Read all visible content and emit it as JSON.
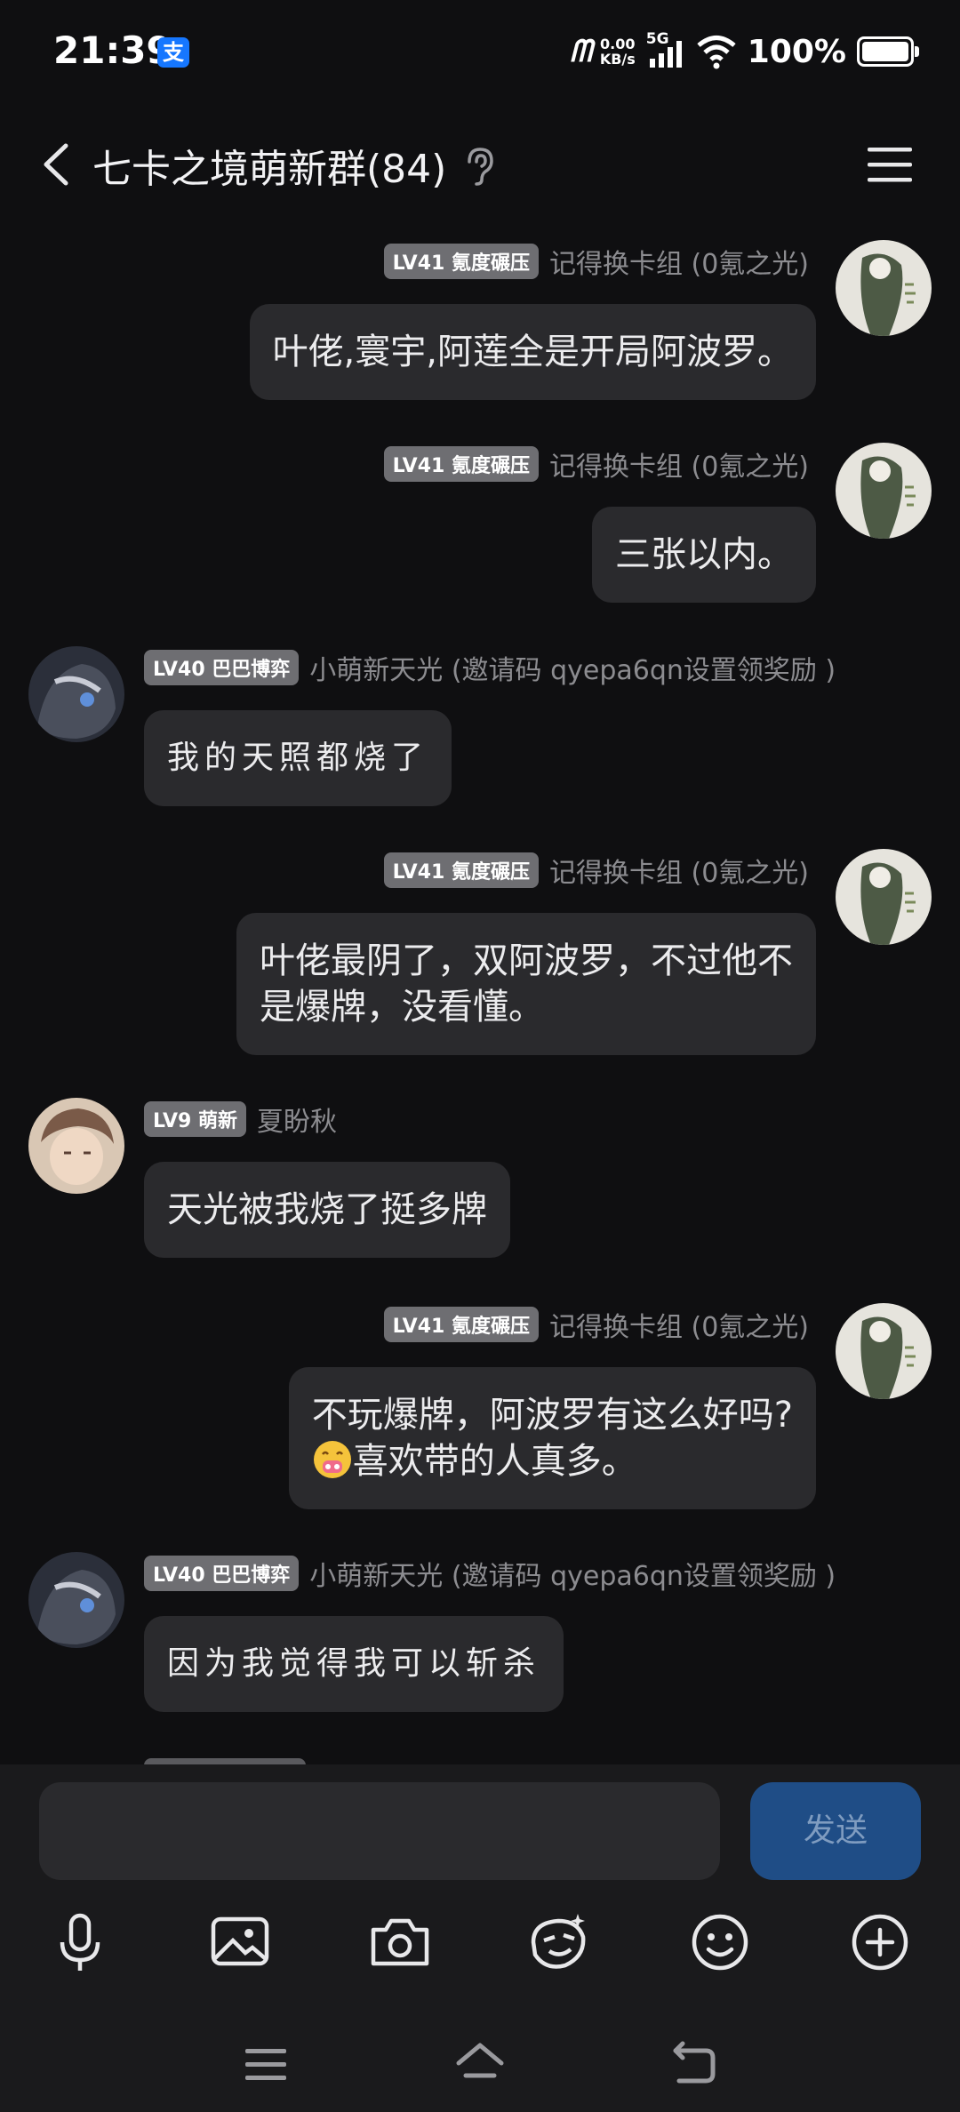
{
  "status_bar": {
    "time": "21:39",
    "alipay_badge": "支",
    "carrier": "ᗰ",
    "net_speed_value": "0.00",
    "net_speed_unit": "KB/s",
    "network": "5G",
    "battery_pct": "100%"
  },
  "header": {
    "title": "七卡之境萌新群(84)"
  },
  "messages": [
    {
      "side": "right",
      "level": "LV41 氪度碾压",
      "nick": "记得换卡组 (0氪之光)",
      "text": "叶佬,寰宇,阿莲全是开局阿波罗。"
    },
    {
      "side": "right",
      "level": "LV41 氪度碾压",
      "nick": "记得换卡组 (0氪之光)",
      "text": "三张以内。"
    },
    {
      "side": "left",
      "level": "LV40 巴巴博弈",
      "nick": "小萌新天光 (邀请码 qyepa6qn设置领奖励 )",
      "text": "我的天照都烧了"
    },
    {
      "side": "right",
      "level": "LV41 氪度碾压",
      "nick": "记得换卡组 (0氪之光)",
      "text_line1": "叶佬最阴了，双阿波罗，不过他不",
      "text_line2": "是爆牌，没看懂。"
    },
    {
      "side": "left",
      "level": "LV9 萌新",
      "nick": "夏盼秋",
      "text": "天光被我烧了挺多牌"
    },
    {
      "side": "right",
      "level": "LV41 氪度碾压",
      "nick": "记得换卡组 (0氪之光)",
      "text_line1": "不玩爆牌，阿波罗有这么好吗?",
      "text_line2": "喜欢带的人真多。",
      "emoji": "money-mouth-face-emoji"
    },
    {
      "side": "left",
      "level": "LV40 巴巴博弈",
      "nick": "小萌新天光 (邀请码 qyepa6qn设置领奖励 )",
      "text": "因为我觉得我可以斩杀"
    }
  ],
  "composer": {
    "input_value": "",
    "send_label": "发送"
  },
  "toolbar_icons": [
    "microphone-icon",
    "image-icon",
    "camera-icon",
    "sticker-icon",
    "emoji-icon",
    "plus-icon"
  ],
  "nav_icons": [
    "menu-icon",
    "home-icon",
    "back-icon"
  ],
  "colors": {
    "background": "#0f0f11",
    "bubble": "#2a2a2d",
    "level_badge": "#6e6e72",
    "send_button": "#1f4d86"
  }
}
